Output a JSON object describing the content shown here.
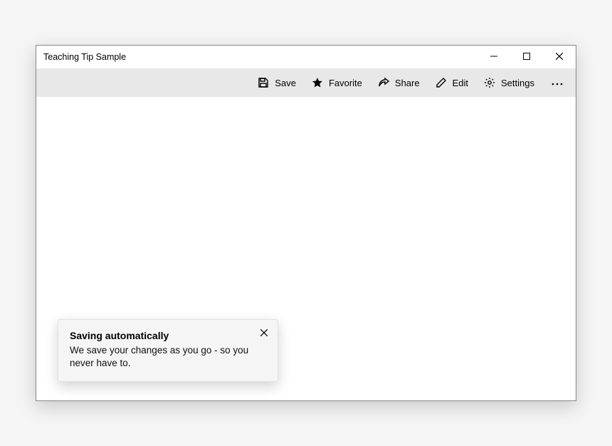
{
  "window": {
    "title": "Teaching Tip Sample"
  },
  "commandbar": {
    "save": "Save",
    "favorite": "Favorite",
    "share": "Share",
    "edit": "Edit",
    "settings": "Settings"
  },
  "teaching_tip": {
    "title": "Saving automatically",
    "body": "We save your changes as you go - so you never have to."
  }
}
